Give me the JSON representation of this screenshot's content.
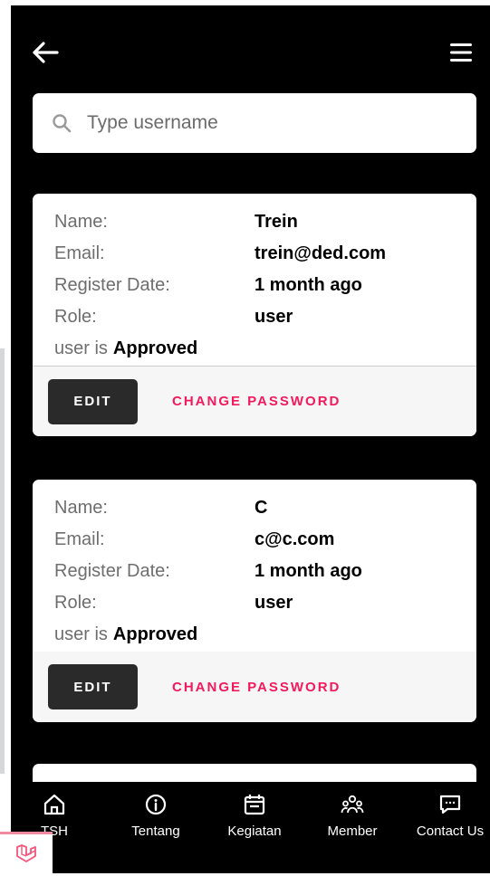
{
  "search": {
    "placeholder": "Type username"
  },
  "users": [
    {
      "name_label": "Name:",
      "name": "Trein",
      "email_label": "Email:",
      "email": "trein@ded.com",
      "date_label": "Register Date:",
      "date": "1 month ago",
      "role_label": "Role:",
      "role": "user",
      "status_prefix": "user is",
      "status": "Approved",
      "edit_label": "EDIT",
      "password_label": "CHANGE PASSWORD"
    },
    {
      "name_label": "Name:",
      "name": "C",
      "email_label": "Email:",
      "email": "c@c.com",
      "date_label": "Register Date:",
      "date": "1 month ago",
      "role_label": "Role:",
      "role": "user",
      "status_prefix": "user is",
      "status": "Approved",
      "edit_label": "EDIT",
      "password_label": "CHANGE PASSWORD"
    }
  ],
  "nav": [
    {
      "label": "TSH",
      "icon": "home-icon"
    },
    {
      "label": "Tentang",
      "icon": "info-icon"
    },
    {
      "label": "Kegiatan",
      "icon": "calendar-icon"
    },
    {
      "label": "Member",
      "icon": "people-icon"
    },
    {
      "label": "Contact Us",
      "icon": "chat-icon"
    }
  ],
  "colors": {
    "accent": "#f2195c",
    "background": "#000000",
    "button": "#2a2a2a"
  }
}
